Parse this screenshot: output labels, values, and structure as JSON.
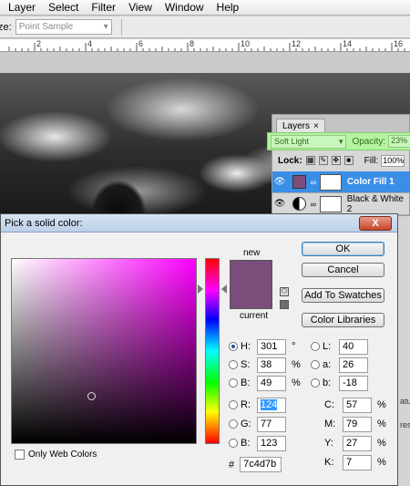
{
  "menu": [
    "Layer",
    "Select",
    "Filter",
    "View",
    "Window",
    "Help"
  ],
  "options_bar": {
    "size_label": "ze:",
    "sample_value": "Point Sample"
  },
  "ruler": {
    "numbers": [
      "2",
      "4",
      "6",
      "8",
      "10",
      "12",
      "14",
      "16"
    ]
  },
  "layers_panel": {
    "tab_label": "Layers",
    "tab_close": "×",
    "blend_mode": "Soft Light",
    "opacity_label": "Opacity:",
    "opacity_value": "23%",
    "lock_label": "Lock:",
    "fill_label": "Fill:",
    "fill_value": "100%",
    "layers": [
      {
        "name": "Color Fill 1",
        "selected": true,
        "thumb_color": "#7c4d7b"
      },
      {
        "name": "Black & White 2",
        "selected": false
      }
    ]
  },
  "right_panel_fragments": [
    "atur",
    "ress"
  ],
  "dialog": {
    "title": "Pick a solid color:",
    "close_label": "X",
    "new_label": "new",
    "current_label": "current",
    "new_color": "#7c4d7b",
    "current_color": "#7c4d7b",
    "buttons": {
      "ok": "OK",
      "cancel": "Cancel",
      "add_swatches": "Add To Swatches",
      "color_libraries": "Color Libraries"
    },
    "hsb": [
      {
        "label": "H:",
        "value": "301",
        "unit": "°",
        "checked": true
      },
      {
        "label": "S:",
        "value": "38",
        "unit": "%",
        "checked": false
      },
      {
        "label": "B:",
        "value": "49",
        "unit": "%",
        "checked": false
      }
    ],
    "lab": [
      {
        "label": "L:",
        "value": "40"
      },
      {
        "label": "a:",
        "value": "26"
      },
      {
        "label": "b:",
        "value": "-18"
      }
    ],
    "rgb": [
      {
        "label": "R:",
        "value": "124"
      },
      {
        "label": "G:",
        "value": "77"
      },
      {
        "label": "B:",
        "value": "123"
      }
    ],
    "cmyk": [
      {
        "label": "C:",
        "value": "57",
        "unit": "%"
      },
      {
        "label": "M:",
        "value": "79",
        "unit": "%"
      },
      {
        "label": "Y:",
        "value": "27",
        "unit": "%"
      },
      {
        "label": "K:",
        "value": "7",
        "unit": "%"
      }
    ],
    "hex_prefix": "#",
    "hex_value": "7c4d7b",
    "web_colors_label": "Only Web Colors"
  }
}
